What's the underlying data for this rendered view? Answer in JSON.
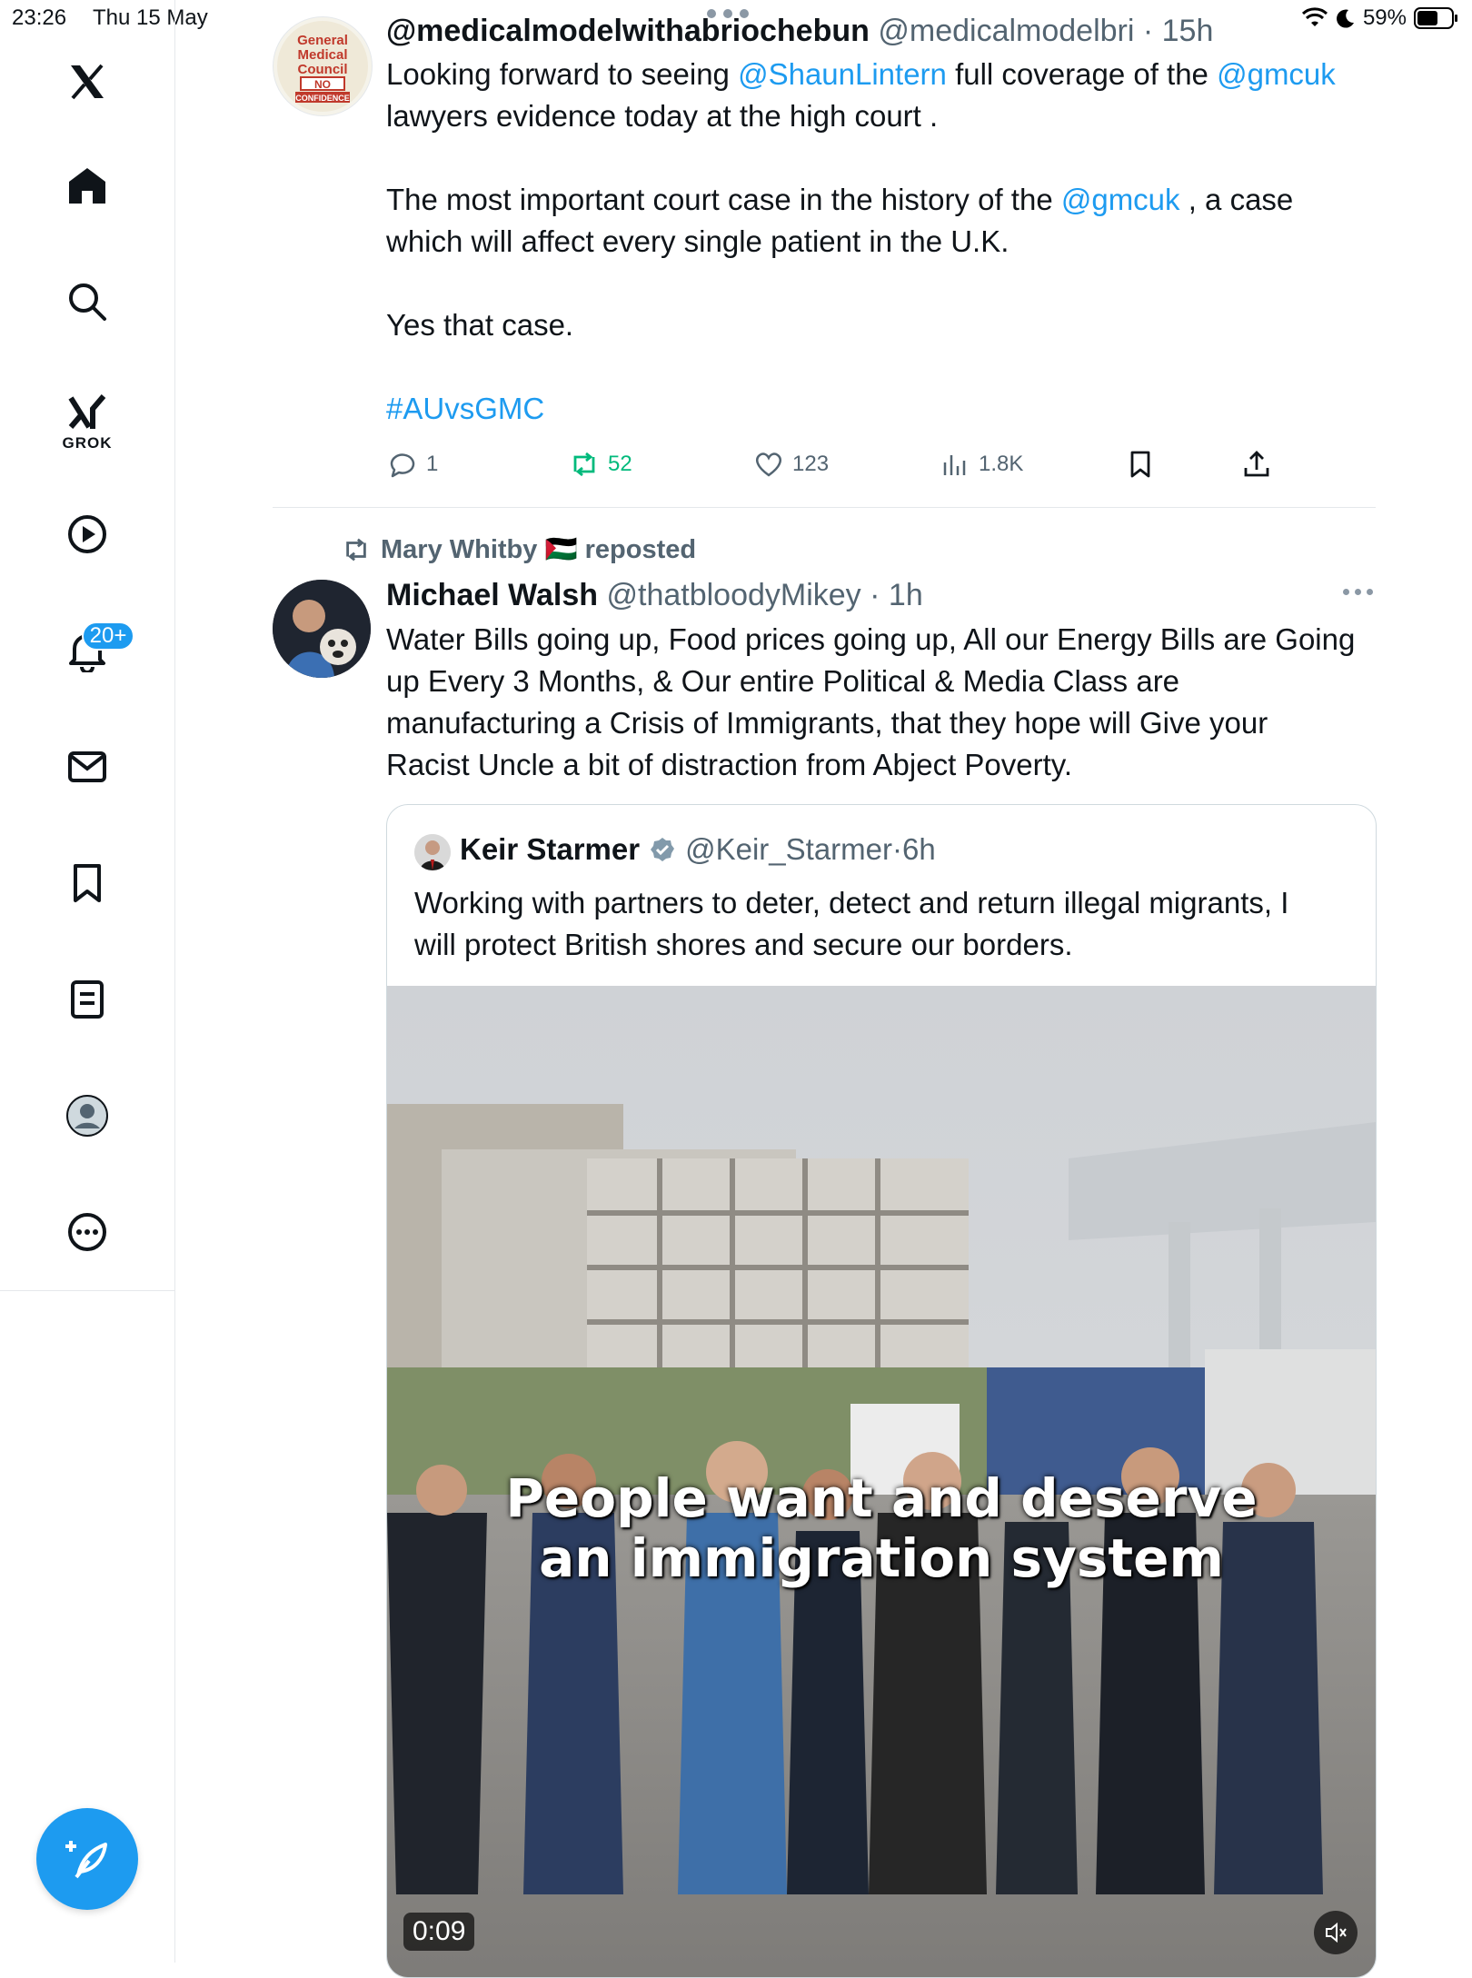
{
  "status_bar": {
    "time": "23:26",
    "date": "Thu 15 May",
    "battery": "59%"
  },
  "sidebar": {
    "grok_label": "GROK",
    "notifications_badge": "20+"
  },
  "tweet1": {
    "display_name": "@medicalmodelwithabriochebun",
    "handle": "@medicalmodelbri",
    "time": "15h",
    "line1_pre": "Looking forward to seeing ",
    "line1_mention1": "@ShaunLintern",
    "line1_mid": " full coverage of the ",
    "line1_mention2": "@gmcuk",
    "line2": "lawyers evidence today at the high court .",
    "line3_pre": "The most important court case in the history of the ",
    "line3_mention": "@gmcuk",
    "line3_post": " , a case",
    "line4": "which will affect every single patient in the U.K.",
    "line5": "Yes that case.",
    "hashtag": "#AUvsGMC",
    "replies": "1",
    "reposts": "52",
    "likes": "123",
    "views": "1.8K",
    "avatar_text": [
      "General",
      "Medical",
      "Council",
      "NO",
      "CONFIDENCE"
    ]
  },
  "tweet2": {
    "repost_by": "Mary Whitby 🇵🇸 reposted",
    "display_name": "Michael Walsh",
    "handle": "@thatbloodyMikey",
    "time": "1h",
    "lines": [
      "Water Bills going up, Food prices going up, All our Energy Bills are Going",
      "up Every 3 Months, & Our entire Political & Media Class are",
      "manufacturing a Crisis of Immigrants, that they hope will Give your",
      "Racist Uncle a bit of distraction from Abject Poverty."
    ]
  },
  "quote": {
    "display_name": "Keir Starmer",
    "handle": "@Keir_Starmer",
    "time": "6h",
    "lines": [
      "Working with partners to deter, detect and return illegal migrants, I",
      "will protect British shores and secure our borders."
    ],
    "video_caption_line1": "People want and deserve",
    "video_caption_line2": "an immigration system",
    "video_time": "0:09"
  },
  "colors": {
    "accent": "#1d9bf0",
    "repost_active": "#00ba7c",
    "secondary_text": "#536471",
    "divider": "#e5e8eb"
  },
  "icons": {
    "sidebar": [
      "x-logo-icon",
      "home-icon",
      "search-icon",
      "grok-icon",
      "video-play-icon",
      "notifications-bell-icon",
      "messages-mail-icon",
      "bookmarks-icon",
      "lists-icon",
      "profile-avatar-icon",
      "more-circle-icon"
    ],
    "actions": [
      "reply-icon",
      "repost-icon",
      "like-heart-icon",
      "views-chart-icon",
      "bookmark-icon",
      "share-upload-icon"
    ]
  }
}
